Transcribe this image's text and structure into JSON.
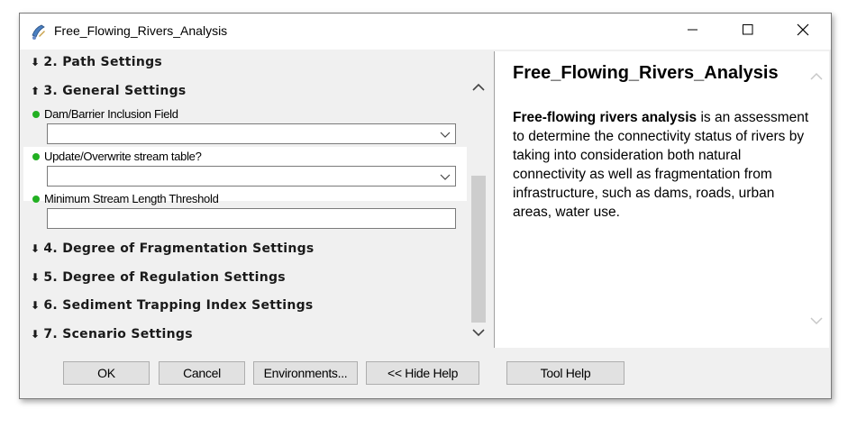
{
  "window": {
    "title": "Free_Flowing_Rivers_Analysis",
    "app_icon": "arcgis-tool-icon",
    "controls": {
      "minimize": "minimize-icon",
      "maximize": "maximize-icon",
      "close": "close-icon"
    }
  },
  "sections": [
    {
      "label": "2. Path Settings",
      "state": "collapsed"
    },
    {
      "label": "3. General Settings",
      "state": "expanded"
    },
    {
      "label": "4. Degree of Fragmentation Settings",
      "state": "collapsed"
    },
    {
      "label": "5. Degree of Regulation Settings",
      "state": "collapsed"
    },
    {
      "label": "6. Sediment Trapping Index Settings",
      "state": "collapsed"
    },
    {
      "label": "7. Scenario Settings",
      "state": "collapsed"
    }
  ],
  "general_settings": {
    "fields": [
      {
        "label": "Dam/Barrier Inclusion Field",
        "type": "dropdown",
        "value": ""
      },
      {
        "label": "Update/Overwrite stream table?",
        "type": "dropdown",
        "value": ""
      },
      {
        "label": "Minimum Stream Length Threshold",
        "type": "text",
        "value": ""
      }
    ]
  },
  "help": {
    "title": "Free_Flowing_Rivers_Analysis",
    "body_bold": "Free-flowing rivers analysis",
    "body_rest": " is an assessment to determine the connectivity status of rivers by taking into consideration both natural connectivity as well as fragmentation from infrastructure, such as dams, roads, urban areas, water use."
  },
  "buttons": {
    "ok": "OK",
    "cancel": "Cancel",
    "environments": "Environments...",
    "hide_help": "<< Hide Help",
    "tool_help": "Tool Help"
  },
  "colors": {
    "required_dot": "#22b022",
    "accent_blue": "#2b6cb0"
  }
}
